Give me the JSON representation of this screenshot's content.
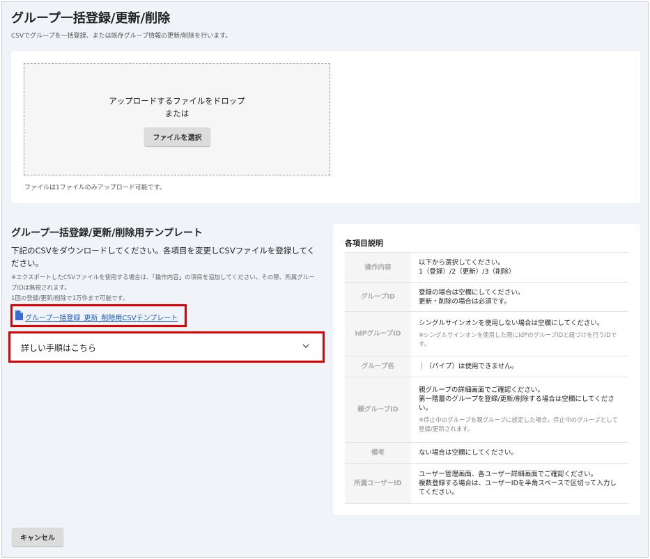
{
  "header": {
    "title": "グループ一括登録/更新/削除",
    "description": "CSVでグループを一括登録、または既存グループ情報の更新/削除を行います。"
  },
  "upload": {
    "drop_text": "アップロードするファイルをドロップ",
    "or_text": "または",
    "select_button": "ファイルを選択",
    "note": "ファイルは1ファイルのみアップロード可能です。"
  },
  "template": {
    "title": "グループ一括登録/更新/削除用テンプレート",
    "description": "下記のCSVをダウンロードしてください。各項目を変更しCSVファイルを登録してください。",
    "note_1": "※エクスポートしたCSVファイルを使用する場合は、「操作内容」の項目を追加してください。その際、所属グループIDは無視されます。",
    "note_2": "1回の登録/更新/削除で1万件まで可能です。",
    "download_link": "グループ一括登録_更新_削除用CSVテンプレート",
    "accordion_label": "詳しい手順はこちら"
  },
  "descriptions": {
    "title": "各項目説明",
    "rows": [
      {
        "key": "操作内容",
        "lines": [
          "以下から選択してください。",
          "1（登録）/2（更新）/3（削除）"
        ],
        "sub": ""
      },
      {
        "key": "グループID",
        "lines": [
          "登録の場合は空欄にしてください。",
          "更新・削除の場合は必須です。"
        ],
        "sub": ""
      },
      {
        "key": "IdPグループID",
        "lines": [
          "シングルサインオンを使用しない場合は空欄にしてください。"
        ],
        "sub": "※シングルサインオンを使用した際にIdPのグループIDと紐づけを行うIDです。"
      },
      {
        "key": "グループ名",
        "lines": [
          "｜（パイプ）は使用できません。"
        ],
        "sub": ""
      },
      {
        "key": "親グループID",
        "lines": [
          "親グループの詳細画面でご確認ください。",
          "第一階層のグループを登録/更新/削除する場合は空欄にしてください。"
        ],
        "sub": "※停止中のグループを親グループに設定した場合、停止中のグループとして登録/更新されます。"
      },
      {
        "key": "備考",
        "lines": [
          "ない場合は空欄にしてください。"
        ],
        "sub": ""
      },
      {
        "key": "所属ユーザーID",
        "lines": [
          "ユーザー管理画面、各ユーザー詳細画面でご確認ください。",
          "複数登録する場合は、ユーザーIDを半角スペースで区切って入力してください。"
        ],
        "sub": ""
      }
    ]
  },
  "footer": {
    "cancel_button": "キャンセル"
  },
  "icons": {
    "download": "document-icon",
    "accordion": "chevron-down-icon"
  },
  "colors": {
    "link": "#1a5bbf",
    "highlight": "#e00000",
    "background": "#f0f4f9"
  }
}
